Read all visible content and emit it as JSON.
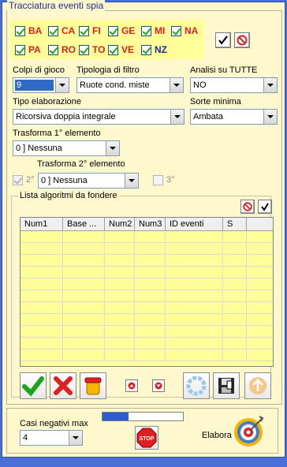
{
  "window": {
    "title": "Tracciatura eventi spia"
  },
  "wheels": [
    {
      "label": "BA",
      "checked": true,
      "color": "red"
    },
    {
      "label": "CA",
      "checked": true,
      "color": "red"
    },
    {
      "label": "FI",
      "checked": true,
      "color": "red"
    },
    {
      "label": "GE",
      "checked": true,
      "color": "red"
    },
    {
      "label": "MI",
      "checked": true,
      "color": "red"
    },
    {
      "label": "NA",
      "checked": true,
      "color": "red"
    },
    {
      "label": "PA",
      "checked": true,
      "color": "red"
    },
    {
      "label": "RO",
      "checked": true,
      "color": "red"
    },
    {
      "label": "TO",
      "checked": true,
      "color": "red"
    },
    {
      "label": "VE",
      "checked": true,
      "color": "red"
    },
    {
      "label": "NZ",
      "checked": true,
      "color": "blue"
    }
  ],
  "fields": {
    "colpi": {
      "label": "Colpi di gioco",
      "value": "9"
    },
    "tipologia": {
      "label": "Tipologia di filtro",
      "value": "Ruote cond. miste"
    },
    "analisi": {
      "label": "Analisi su TUTTE",
      "value": "NO"
    },
    "tipo_elab": {
      "label": "Tipo elaborazione",
      "value": "Ricorsiva doppia integrale"
    },
    "sorte": {
      "label": "Sorte minima",
      "value": "Ambata"
    },
    "trasf1": {
      "label": "Trasforma 1° elemento",
      "value": "0 ] Nessuna"
    },
    "trasf2": {
      "label": "Trasforma 2° elemento",
      "value": "0 ] Nessuna"
    },
    "opt2": {
      "label": "2°"
    },
    "opt3": {
      "label": "3°"
    }
  },
  "list": {
    "title": "Lista algoritmi da fondere",
    "columns": [
      "Num1",
      "Base ...",
      "Num2",
      "Num3",
      "ID eventi",
      "S"
    ]
  },
  "bottom": {
    "casi_label": "Casi negativi max",
    "casi_value": "4",
    "elabora_label": "Elabora",
    "stop_label": "STOP",
    "progress": 0.32
  },
  "colors": {
    "red": "#e02020",
    "blue": "#1c2d9a",
    "accent": "#316ac5",
    "panel": "#fff8cc",
    "grid": "#ffff99"
  }
}
